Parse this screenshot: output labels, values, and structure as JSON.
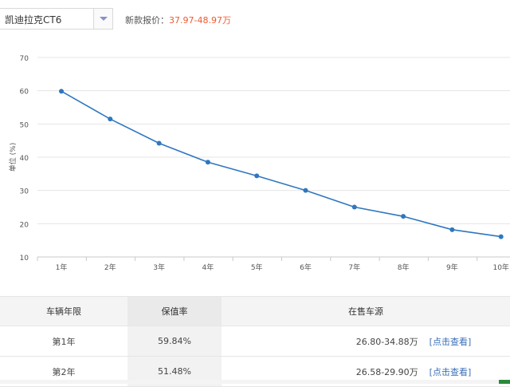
{
  "model_select": {
    "value": "凯迪拉克CT6"
  },
  "price": {
    "label": "新款报价：",
    "value": "37.97-48.97万"
  },
  "chart_data": {
    "type": "line",
    "ylabel": "单位 (%)",
    "ylim": [
      10,
      70
    ],
    "yticks": [
      10,
      20,
      30,
      40,
      50,
      60,
      70
    ],
    "categories": [
      "1年",
      "2年",
      "3年",
      "4年",
      "5年",
      "6年",
      "7年",
      "8年",
      "9年",
      "10年"
    ],
    "values": [
      59.84,
      51.48,
      44.2,
      38.5,
      34.4,
      30.0,
      25.0,
      22.2,
      18.2,
      16.1
    ],
    "grid": true,
    "color": "#2f77c0"
  },
  "table": {
    "headers": [
      "车辆年限",
      "保值率",
      "在售车源"
    ],
    "rows": [
      {
        "year": "第1年",
        "rate": "59.84%",
        "source": "26.80-34.88万",
        "link": "[点击查看]"
      },
      {
        "year": "第2年",
        "rate": "51.48%",
        "source": "26.58-29.90万",
        "link": "[点击查看]"
      }
    ]
  }
}
